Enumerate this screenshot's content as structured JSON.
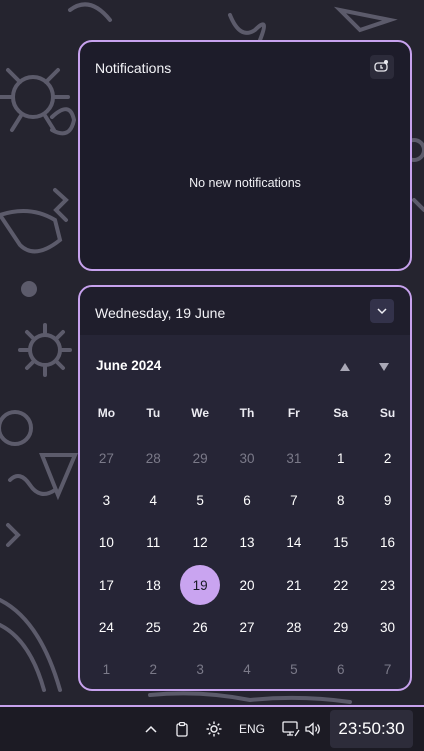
{
  "notifications": {
    "title": "Notifications",
    "empty_message": "No new notifications"
  },
  "calendar": {
    "date_header": "Wednesday, 19 June",
    "month_label": "June 2024",
    "weekdays": [
      "Mo",
      "Tu",
      "We",
      "Th",
      "Fr",
      "Sa",
      "Su"
    ],
    "days": [
      {
        "label": "27",
        "muted": true
      },
      {
        "label": "28",
        "muted": true
      },
      {
        "label": "29",
        "muted": true
      },
      {
        "label": "30",
        "muted": true
      },
      {
        "label": "31",
        "muted": true
      },
      {
        "label": "1"
      },
      {
        "label": "2"
      },
      {
        "label": "3"
      },
      {
        "label": "4"
      },
      {
        "label": "5"
      },
      {
        "label": "6"
      },
      {
        "label": "7"
      },
      {
        "label": "8"
      },
      {
        "label": "9"
      },
      {
        "label": "10"
      },
      {
        "label": "11"
      },
      {
        "label": "12"
      },
      {
        "label": "13"
      },
      {
        "label": "14"
      },
      {
        "label": "15"
      },
      {
        "label": "16"
      },
      {
        "label": "17"
      },
      {
        "label": "18"
      },
      {
        "label": "19",
        "selected": true
      },
      {
        "label": "20"
      },
      {
        "label": "21"
      },
      {
        "label": "22"
      },
      {
        "label": "23"
      },
      {
        "label": "24"
      },
      {
        "label": "25"
      },
      {
        "label": "26"
      },
      {
        "label": "27"
      },
      {
        "label": "28"
      },
      {
        "label": "29"
      },
      {
        "label": "30"
      },
      {
        "label": "1",
        "muted": true
      },
      {
        "label": "2",
        "muted": true
      },
      {
        "label": "3",
        "muted": true
      },
      {
        "label": "4",
        "muted": true
      },
      {
        "label": "5",
        "muted": true
      },
      {
        "label": "6",
        "muted": true
      },
      {
        "label": "7",
        "muted": true
      }
    ]
  },
  "taskbar": {
    "language": "ENG",
    "clock": "23:50:30",
    "icons": [
      "chevron-up-icon",
      "clipboard-icon",
      "brightness-icon",
      "network-icon",
      "volume-icon"
    ]
  },
  "colors": {
    "accent": "#c7a2ee",
    "selected_day": "#c9a4f0",
    "panel_bg": "#1d1c2a"
  }
}
